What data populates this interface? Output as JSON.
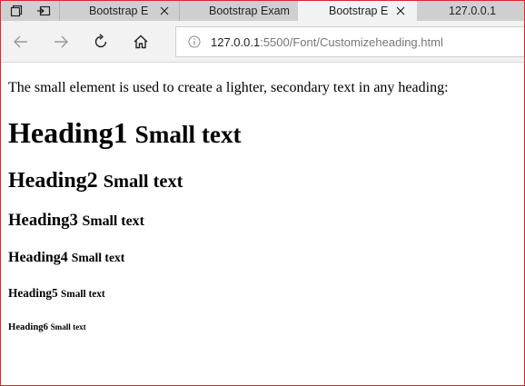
{
  "browser": {
    "tabs": [
      {
        "label": "Bootstrap E",
        "active": false
      },
      {
        "label": "Bootstrap Exam",
        "active": false
      },
      {
        "label": "Bootstrap E",
        "active": true
      },
      {
        "label": "127.0.0.1",
        "active": false
      }
    ],
    "url": {
      "host": "127.0.0.1",
      "path": ":5500/Font/Customizeheading.html"
    },
    "icons": {
      "tab_manager": "tab-manager-icon",
      "set_aside": "set-aside-tabs-icon",
      "close": "close-icon",
      "back": "back-arrow-icon",
      "forward": "forward-arrow-icon",
      "refresh": "refresh-icon",
      "home": "home-icon",
      "info": "info-icon"
    },
    "colors": {
      "tabstrip": "#cfcfcf",
      "active_tab": "#f2f2f2",
      "window_border": "#e0252d"
    }
  },
  "page": {
    "intro": "The small element is used to create a lighter, secondary text in any heading:",
    "headings": [
      {
        "text": "Heading1",
        "small": "Small text"
      },
      {
        "text": "Heading2",
        "small": "Small text"
      },
      {
        "text": "Heading3",
        "small": "Small text"
      },
      {
        "text": "Heading4",
        "small": "Small text"
      },
      {
        "text": "Heading5",
        "small": "Small text"
      },
      {
        "text": "Heading6",
        "small": "Small text"
      }
    ]
  }
}
